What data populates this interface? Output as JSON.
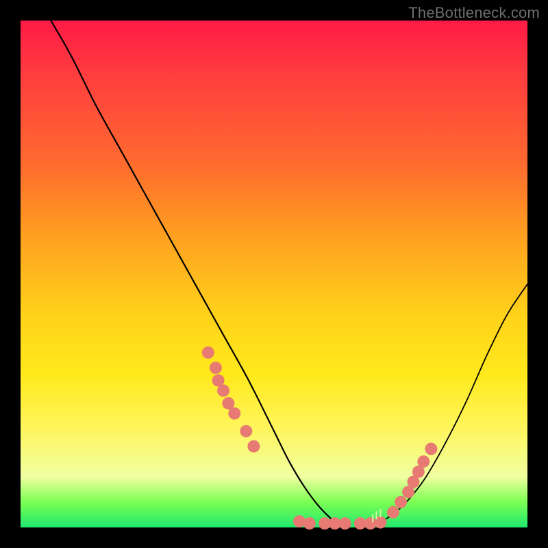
{
  "watermark": "TheBottleneck.com",
  "colors": {
    "background": "#000000",
    "gradient_top": "#ff1a46",
    "gradient_mid": "#ffd21a",
    "gradient_bottom": "#1fe86e",
    "curve": "#000000",
    "dot": "#e77a73"
  },
  "chart_data": {
    "type": "line",
    "title": "",
    "xlabel": "",
    "ylabel": "",
    "xlim": [
      0,
      100
    ],
    "ylim": [
      0,
      100
    ],
    "series": [
      {
        "name": "left-curve",
        "x": [
          6,
          10,
          15,
          20,
          25,
          30,
          35,
          40,
          45,
          50,
          53,
          56,
          59,
          62
        ],
        "values": [
          100,
          93,
          83,
          74,
          65,
          56,
          47,
          38,
          29,
          19,
          13,
          8,
          4,
          1
        ]
      },
      {
        "name": "right-curve",
        "x": [
          71,
          74,
          77,
          80,
          84,
          88,
          92,
          96,
          100
        ],
        "values": [
          1,
          3,
          6,
          10,
          17,
          25,
          34,
          42,
          48
        ]
      }
    ],
    "dots_left": {
      "x": [
        37.0,
        38.5,
        39.0,
        40.0,
        41.0,
        42.2,
        44.5,
        46.0
      ],
      "values": [
        34.5,
        31.5,
        29.0,
        27.0,
        24.5,
        22.5,
        19.0,
        16.0
      ]
    },
    "dots_bottom": {
      "x": [
        55.0,
        57.0,
        60.0,
        62.0,
        64.0,
        67.0,
        69.0,
        71.0
      ],
      "values": [
        1.2,
        0.8,
        0.8,
        0.8,
        0.8,
        0.8,
        0.8,
        1.0
      ]
    },
    "dots_right": {
      "x": [
        73.5,
        75.0,
        76.5,
        77.5,
        78.5,
        79.5,
        81.0
      ],
      "values": [
        3.0,
        5.0,
        7.0,
        9.0,
        11.0,
        13.0,
        15.5
      ]
    },
    "minor_ticks": {
      "x": [
        69.5,
        70.2,
        71.0
      ],
      "values": [
        1.8,
        2.4,
        2.8
      ]
    }
  }
}
